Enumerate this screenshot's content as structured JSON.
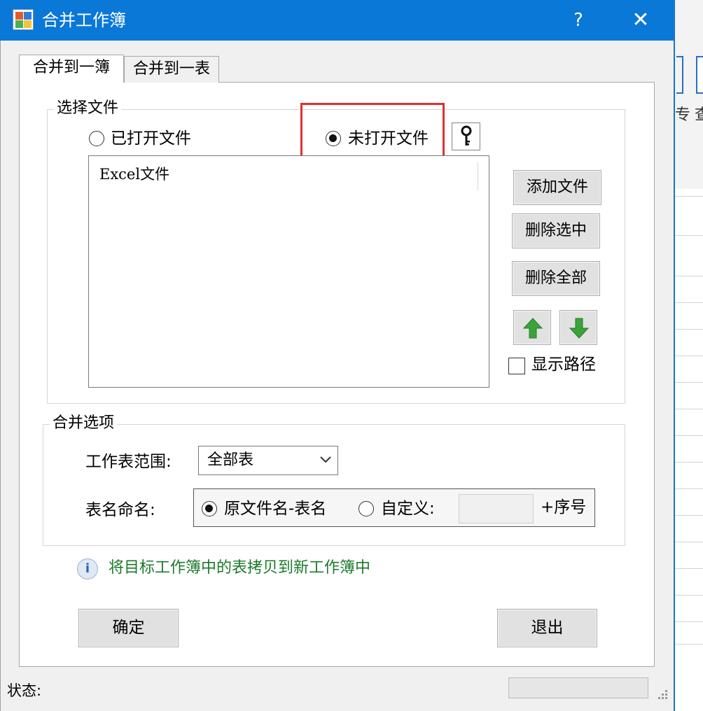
{
  "window": {
    "title": "合并工作簿",
    "help_label": "?",
    "close_label": "✕"
  },
  "background": {
    "ribbon_text_1": "专",
    "ribbon_text_2": "查"
  },
  "tabs": [
    {
      "label": "合并到一簿",
      "active": true
    },
    {
      "label": "合并到一表",
      "active": false
    }
  ],
  "select_files": {
    "group_label": "选择文件",
    "radio_opened": {
      "label": "已打开文件",
      "checked": false
    },
    "radio_unopened": {
      "label": "未打开文件",
      "checked": true
    },
    "key_button_icon": "key-icon",
    "list_header": "Excel文件",
    "buttons": {
      "add": "添加文件",
      "delete_selected": "删除选中",
      "delete_all": "删除全部"
    },
    "show_path": {
      "label": "显示路径",
      "checked": false
    }
  },
  "merge_options": {
    "group_label": "合并选项",
    "sheet_range_label": "工作表范围:",
    "sheet_range_value": "全部表",
    "naming_label": "表名命名:",
    "naming_original": {
      "label": "原文件名-表名",
      "checked": true
    },
    "naming_custom": {
      "label": "自定义:",
      "checked": false
    },
    "custom_input_value": "",
    "suffix_label": "+序号"
  },
  "info": {
    "icon": "info-icon",
    "text": "将目标工作簿中的表拷贝到新工作簿中"
  },
  "actions": {
    "ok": "确定",
    "exit": "退出"
  },
  "status": {
    "label": "状态:"
  },
  "colors": {
    "titlebar": "#0a78d7",
    "highlight_box": "#e03030",
    "info_text": "#1a7a2a",
    "arrow_green": "#3aa339"
  }
}
